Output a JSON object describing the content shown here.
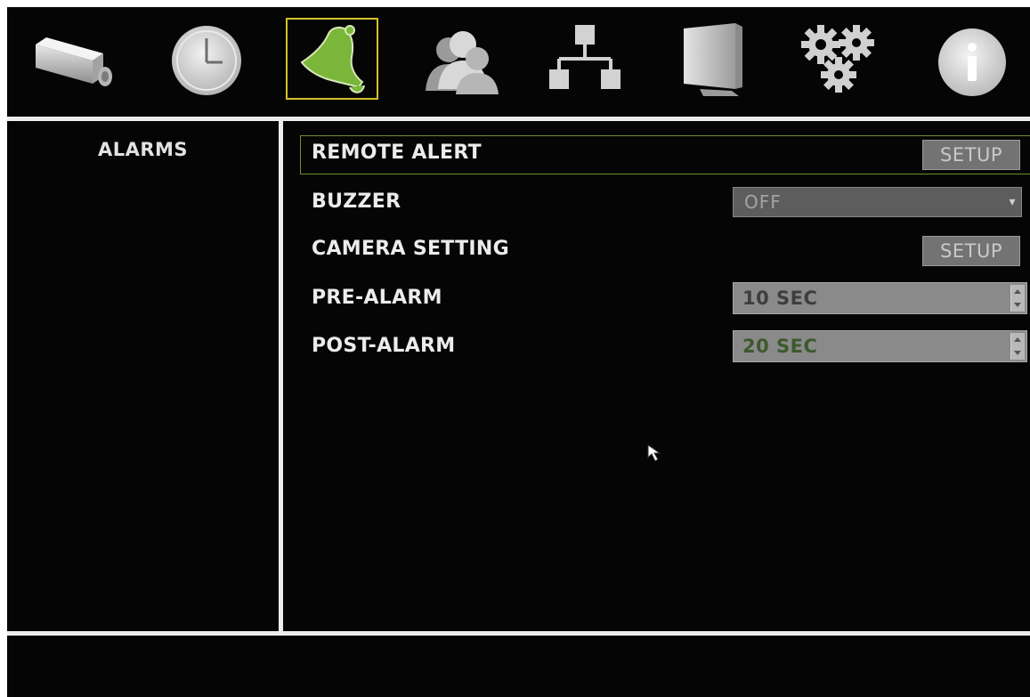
{
  "toolbar": {
    "icons": [
      {
        "name": "camera-icon",
        "active": false
      },
      {
        "name": "clock-icon",
        "active": false
      },
      {
        "name": "alarm-bell-icon",
        "active": true
      },
      {
        "name": "users-icon",
        "active": false
      },
      {
        "name": "network-icon",
        "active": false
      },
      {
        "name": "monitor-icon",
        "active": false
      },
      {
        "name": "gears-icon",
        "active": false
      },
      {
        "name": "info-icon",
        "active": false
      }
    ]
  },
  "sidebar": {
    "title": "ALARMS"
  },
  "settings": {
    "remote_alert": {
      "label": "REMOTE ALERT",
      "button": "SETUP"
    },
    "buzzer": {
      "label": "BUZZER",
      "value": "OFF"
    },
    "camera_setting": {
      "label": "CAMERA SETTING",
      "button": "SETUP"
    },
    "pre_alarm": {
      "label": "PRE-ALARM",
      "value": "10 SEC"
    },
    "post_alarm": {
      "label": "POST-ALARM",
      "value": "20 SEC"
    }
  },
  "colors": {
    "background": "#050505",
    "active_icon": "#7ab63a",
    "highlight_border": "#d2c22a",
    "divider": "#ededed"
  }
}
